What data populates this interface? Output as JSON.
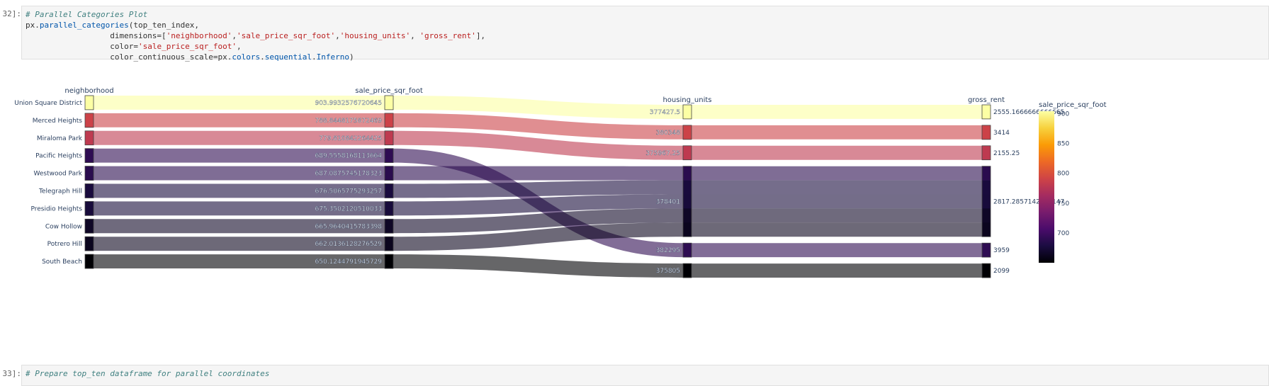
{
  "cells": {
    "top": {
      "prompt": "32]:",
      "lines": [
        [
          {
            "t": "# Parallel Categories Plot",
            "c": "cmt"
          }
        ],
        [
          {
            "t": "px.",
            "c": ""
          },
          {
            "t": "parallel_categories",
            "c": "fn"
          },
          {
            "t": "(top_ten_index,",
            "c": ""
          }
        ],
        [
          {
            "t": "                  dimensions=[",
            "c": ""
          },
          {
            "t": "'neighborhood'",
            "c": "str"
          },
          {
            "t": ",",
            "c": ""
          },
          {
            "t": "'sale_price_sqr_foot'",
            "c": "str"
          },
          {
            "t": ",",
            "c": ""
          },
          {
            "t": "'housing_units'",
            "c": "str"
          },
          {
            "t": ", ",
            "c": ""
          },
          {
            "t": "'gross_rent'",
            "c": "str"
          },
          {
            "t": "],",
            "c": ""
          }
        ],
        [
          {
            "t": "                  color=",
            "c": ""
          },
          {
            "t": "'sale_price_sqr_foot'",
            "c": "str"
          },
          {
            "t": ",",
            "c": ""
          }
        ],
        [
          {
            "t": "                  color_continuous_scale=px.",
            "c": ""
          },
          {
            "t": "colors",
            "c": "fn"
          },
          {
            "t": ".",
            "c": ""
          },
          {
            "t": "sequential",
            "c": "fn"
          },
          {
            "t": ".",
            "c": ""
          },
          {
            "t": "Inferno",
            "c": "fn"
          },
          {
            "t": ")",
            "c": ""
          }
        ]
      ]
    },
    "bottom": {
      "prompt": "33]:",
      "lines": [
        [
          {
            "t": "# Prepare top_ten dataframe for parallel coordinates",
            "c": "cmt"
          }
        ]
      ]
    }
  },
  "chart_data": {
    "type": "parallel_categories",
    "dimensions": [
      {
        "name": "neighborhood",
        "categories": [
          "Union Square District",
          "Merced Heights",
          "Miraloma Park",
          "Pacific Heights",
          "Westwood Park",
          "Telegraph Hill",
          "Presidio Heights",
          "Cow Hollow",
          "Potrero Hill",
          "South Beach"
        ]
      },
      {
        "name": "sale_price_sqr_foot",
        "categories": [
          "903.9932576720645",
          "788.8448175872469",
          "779.810842264425",
          "689.5558168113664",
          "687.0875745178323",
          "676.5065775293257",
          "675.3502120510033",
          "665.9640415783398",
          "662.0136128276529",
          "650.1244791945729"
        ]
      },
      {
        "name": "housing_units",
        "categories": [
          "377427.5",
          "380348",
          "375967.25",
          "378401",
          "382295",
          "375805"
        ]
      },
      {
        "name": "gross_rent",
        "categories": [
          "2555.1666666666665",
          "3414",
          "2155.25",
          "2817.2857142857147",
          "3959",
          "2099"
        ]
      }
    ],
    "records": [
      {
        "neighborhood": "Union Square District",
        "sale_price_sqr_foot": 903.9932576720645,
        "housing_units": 377427.5,
        "gross_rent": 2555.1666666666665
      },
      {
        "neighborhood": "Merced Heights",
        "sale_price_sqr_foot": 788.8448175872469,
        "housing_units": 380348,
        "gross_rent": 3414
      },
      {
        "neighborhood": "Miraloma Park",
        "sale_price_sqr_foot": 779.810842264425,
        "housing_units": 375967.25,
        "gross_rent": 2155.25
      },
      {
        "neighborhood": "Pacific Heights",
        "sale_price_sqr_foot": 689.5558168113664,
        "housing_units": 382295,
        "gross_rent": 3959
      },
      {
        "neighborhood": "Westwood Park",
        "sale_price_sqr_foot": 687.0875745178323,
        "housing_units": 378401,
        "gross_rent": 2817.2857142857147
      },
      {
        "neighborhood": "Telegraph Hill",
        "sale_price_sqr_foot": 676.5065775293257,
        "housing_units": 378401,
        "gross_rent": 2817.2857142857147
      },
      {
        "neighborhood": "Presidio Heights",
        "sale_price_sqr_foot": 675.3502120510033,
        "housing_units": 378401,
        "gross_rent": 2817.2857142857147
      },
      {
        "neighborhood": "Cow Hollow",
        "sale_price_sqr_foot": 665.9640415783398,
        "housing_units": 378401,
        "gross_rent": 2817.2857142857147
      },
      {
        "neighborhood": "Potrero Hill",
        "sale_price_sqr_foot": 662.0136128276529,
        "housing_units": 378401,
        "gross_rent": 2817.2857142857147
      },
      {
        "neighborhood": "South Beach",
        "sale_price_sqr_foot": 650.1244791945729,
        "housing_units": 375805,
        "gross_rent": 2099
      }
    ],
    "color": {
      "by": "sale_price_sqr_foot",
      "scale": "Inferno",
      "colorbar_title": "sale_price_sqr_foot",
      "range": [
        650.1244791945729,
        903.9932576720645
      ],
      "ticks": [
        700,
        750,
        800,
        850,
        900
      ],
      "stops": [
        "#000004",
        "#1b0c41",
        "#4a0c6b",
        "#781c6d",
        "#a52c60",
        "#cf4446",
        "#ed6925",
        "#fb9b06",
        "#f7d13d",
        "#fcffa4"
      ]
    }
  }
}
